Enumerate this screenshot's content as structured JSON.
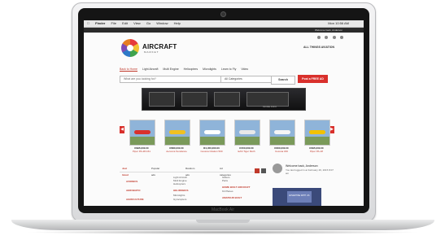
{
  "device": {
    "model": "MacBook Air"
  },
  "menubar": {
    "items": [
      "Finder",
      "File",
      "Edit",
      "View",
      "Go",
      "Window",
      "Help"
    ],
    "clock": "Mon 10:56 AM"
  },
  "topline": {
    "text": "Welcome back, Anderson"
  },
  "site": {
    "logo_main": "AIRCRAFT",
    "logo_sub": "MARKET",
    "tagline": "ALL THINGS AVIATION"
  },
  "nav": {
    "items": [
      "Back to Home",
      "Light Aircraft",
      "Multi Engine",
      "Helicopters",
      "Microlights",
      "Learn to Fly",
      "Video"
    ]
  },
  "search": {
    "placeholder": "What are you looking for?",
    "category": "All Categories",
    "button": "Search",
    "post_ad": "Post a FREE AD"
  },
  "banner": {
    "label": "MORE INFO"
  },
  "listings": [
    {
      "price": "R995,000.00",
      "title": "Piper PA-28-161",
      "color": "#d9302c"
    },
    {
      "price": "R680,000.00",
      "title": "Aeronca Sundance",
      "color": "#f0c020"
    },
    {
      "price": "R4,450,000.00",
      "title": "Cessna Citation 500",
      "color": "#ffffff"
    },
    {
      "price": "R150,000.00",
      "title": "EAS Tiger Moth",
      "color": "#e8e8e8"
    },
    {
      "price": "R200,000.00",
      "title": "Cessna 182",
      "color": "#f5f5f5"
    },
    {
      "price": "R395,000.00",
      "title": "Piper PA-18",
      "color": "#f2c100"
    }
  ],
  "tabs": [
    "Just listed",
    "Popular ads",
    "Random ads",
    "Ad categories"
  ],
  "columns": {
    "col1": [
      "AVIONICS",
      "AEROBATIC",
      "AGRICULTURE"
    ],
    "col2": [
      "Light Aircraft",
      "Multi Engine",
      "Helicopters",
      "HELIROBICS",
      "Microlights",
      "Gyrocopters"
    ],
    "col3": [
      "Gliders",
      "Parts",
      "HOME BUILT AIRCRAFT",
      "Kit Planes",
      "AMATEUR BUILT"
    ]
  },
  "user": {
    "welcome": "Welcome back, Anderson",
    "note": "You last logged in at February 26, 2015 8:07 am"
  },
  "mini_ad": {
    "text": "ADVERTISE WITH US"
  },
  "colors": {
    "accent": "#d9302c",
    "link": "#c0392b"
  }
}
